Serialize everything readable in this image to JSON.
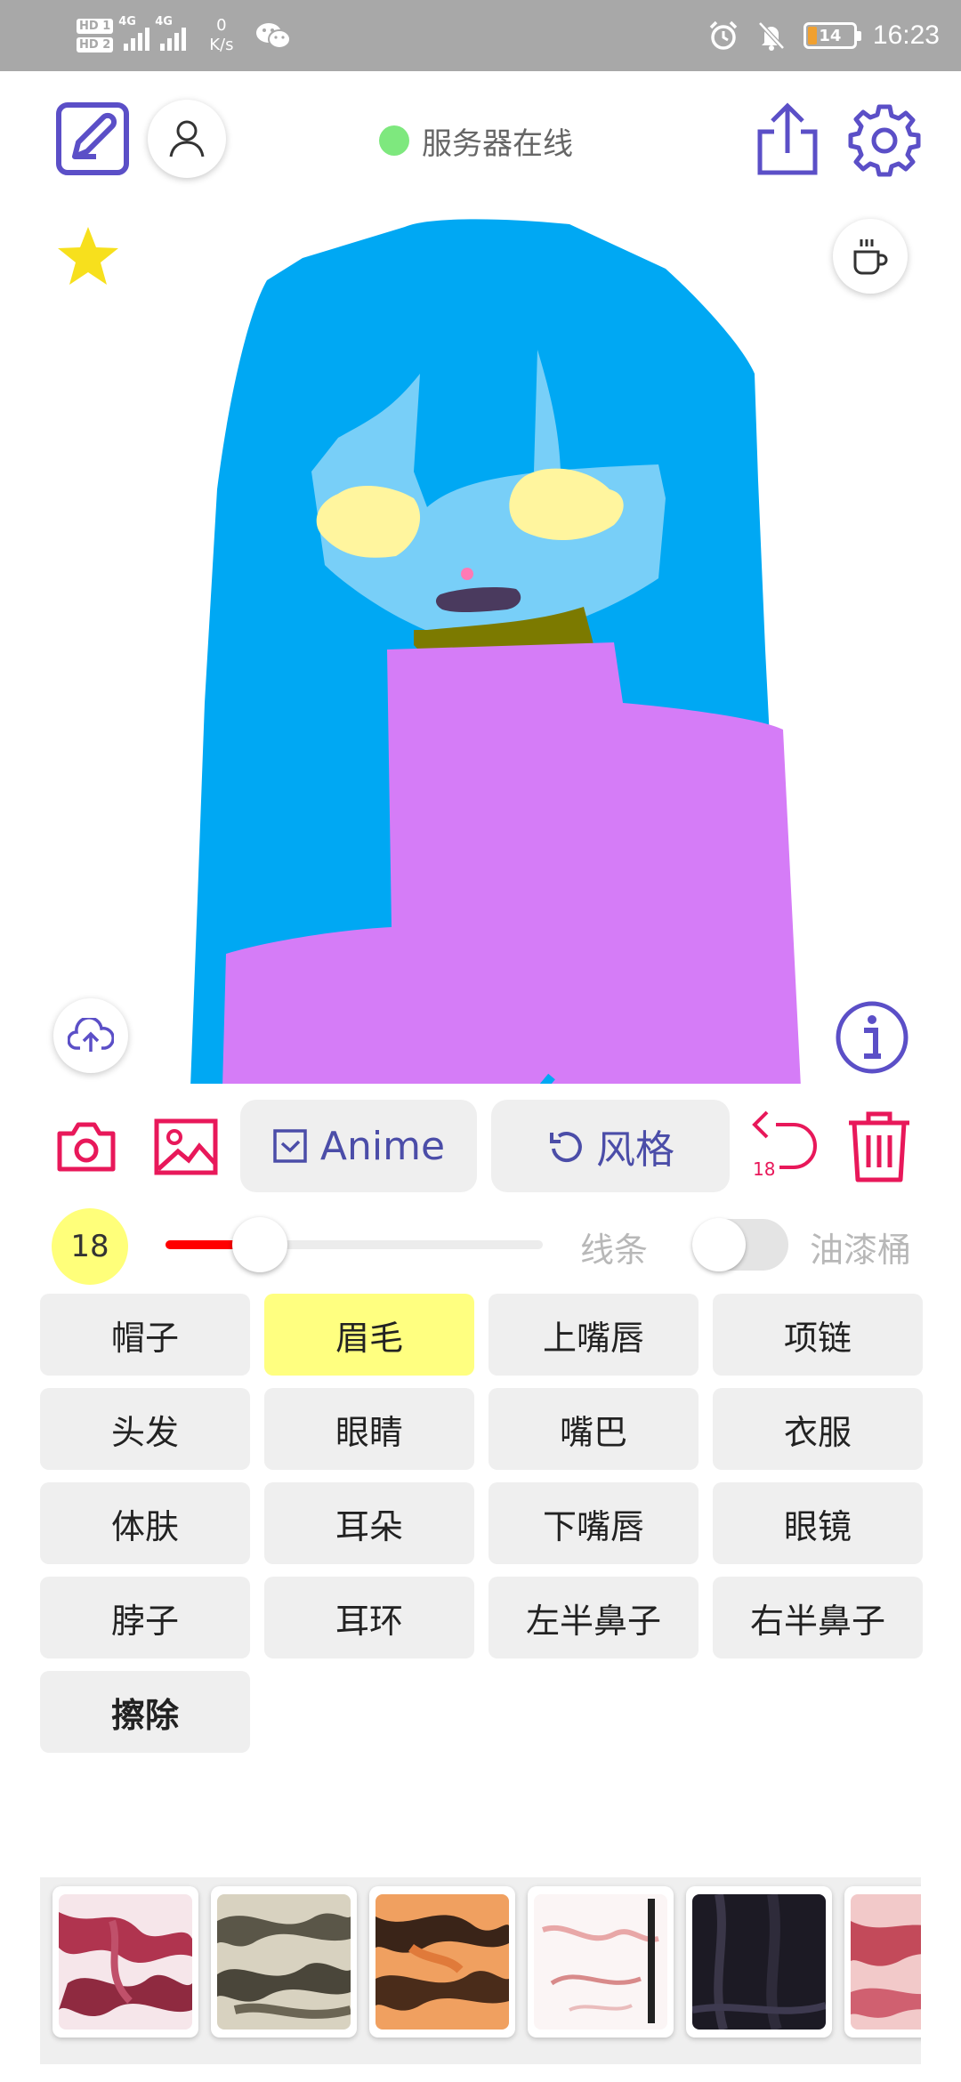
{
  "status_bar": {
    "sim1": "HD 1",
    "sim2": "HD 2",
    "net1": "4G",
    "net2": "4G",
    "speed_value": "0",
    "speed_unit": "K/s",
    "battery": "14",
    "time": "16:23"
  },
  "header": {
    "server_status": "服务器在线",
    "status_color": "#7ee87e"
  },
  "icons": {
    "edit": "edit-icon",
    "user": "user-icon",
    "share": "share-icon",
    "settings": "gear-icon",
    "favorite": "star-icon",
    "coffee": "coffee-icon",
    "upload": "cloud-upload-icon",
    "info": "info-icon",
    "camera": "camera-icon",
    "image": "image-icon",
    "undo": "undo-icon",
    "delete": "trash-icon"
  },
  "toolbar": {
    "anime_label": "Anime",
    "style_label": "风格",
    "undo_count": "18"
  },
  "brush": {
    "size": "18",
    "size_fraction": 0.25,
    "line_label": "线条",
    "bucket_label": "油漆桶",
    "bucket_enabled": false
  },
  "parts": [
    {
      "label": "帽子"
    },
    {
      "label": "眉毛",
      "selected": true
    },
    {
      "label": "上嘴唇"
    },
    {
      "label": "项链"
    },
    {
      "label": "头发"
    },
    {
      "label": "眼睛"
    },
    {
      "label": "嘴巴"
    },
    {
      "label": "衣服"
    },
    {
      "label": "体肤"
    },
    {
      "label": "耳朵"
    },
    {
      "label": "下嘴唇"
    },
    {
      "label": "眼镜"
    },
    {
      "label": "脖子"
    },
    {
      "label": "耳环"
    },
    {
      "label": "左半鼻子"
    },
    {
      "label": "右半鼻子"
    },
    {
      "label": "擦除",
      "bold": true
    }
  ],
  "colors": {
    "accent": "#5b4fc7",
    "danger": "#e8185a",
    "selected": "#ffff80",
    "hair": "#00a8f3",
    "skin": "#78cff8",
    "eyes": "#fff59e",
    "neck": "#7c7a00",
    "clothes": "#d57cf7"
  }
}
